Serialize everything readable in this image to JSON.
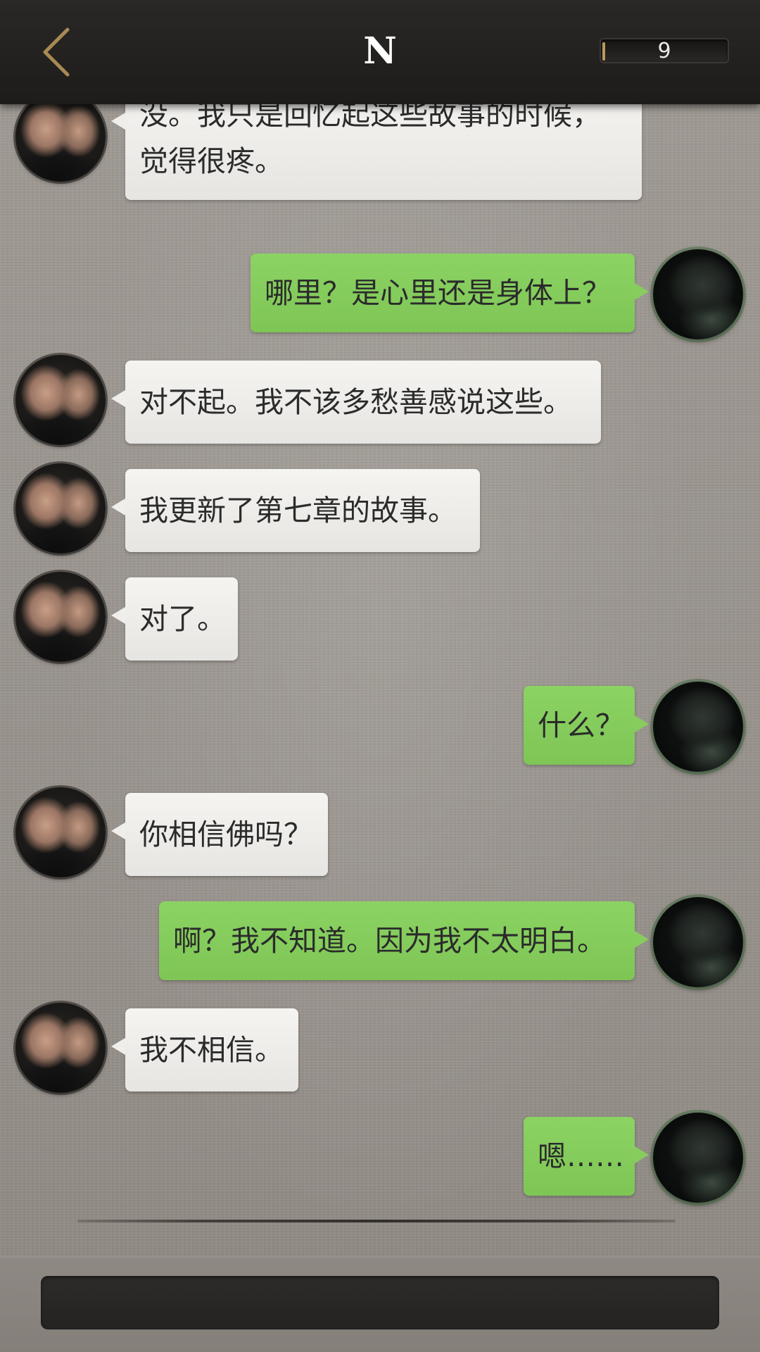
{
  "header": {
    "title": "N",
    "counter": "9",
    "counter_fill_fraction": 0.02
  },
  "messages": [
    {
      "side": "left",
      "text": "没。我只是回忆起这些故事的时候，觉得很疼。"
    },
    {
      "side": "right",
      "text": "哪里？是心里还是身体上？"
    },
    {
      "side": "left",
      "text": "对不起。我不该多愁善感说这些。"
    },
    {
      "side": "left",
      "text": "我更新了第七章的故事。"
    },
    {
      "side": "left",
      "text": "对了。"
    },
    {
      "side": "right",
      "text": "什么？"
    },
    {
      "side": "left",
      "text": "你相信佛吗？"
    },
    {
      "side": "right",
      "text": "啊？我不知道。因为我不太明白。"
    },
    {
      "side": "left",
      "text": "我不相信。"
    },
    {
      "side": "right",
      "text": "嗯……"
    }
  ],
  "input": {
    "placeholder": ""
  },
  "colors": {
    "header_bg": "#1e1c1b",
    "accent_gold": "#b89a5a",
    "bubble_left": "#efeeeb",
    "bubble_right": "#86cc5e",
    "input_bg": "#262524"
  }
}
